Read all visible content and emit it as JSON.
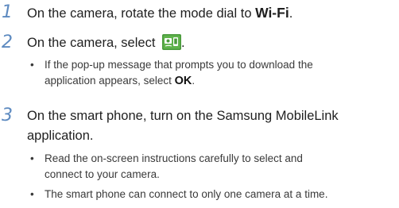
{
  "steps": [
    {
      "number": "1",
      "text_before": "On the camera, rotate the mode dial to ",
      "emphasis": "Wi-Fi",
      "text_after": "."
    },
    {
      "number": "2",
      "text_before": "On the camera, select ",
      "icon": "mobilelink-app-icon",
      "text_after": ".",
      "bullets": [
        {
          "line1": "If the pop-up message that prompts you to download the",
          "line2_before": "application appears, select ",
          "line2_bold": "OK",
          "line2_after": "."
        }
      ]
    },
    {
      "number": "3",
      "line1": "On the smart phone, turn on the Samsung MobileLink",
      "line2": "application.",
      "bullets": [
        {
          "line1": "Read the on-screen instructions carefully to select and",
          "line2": "connect to your camera."
        },
        {
          "line1": "The smart phone can connect to only one camera at a time."
        }
      ]
    }
  ],
  "bullet_glyph": "•",
  "colors": {
    "step_number": "#5d8ac0",
    "icon_green": "#4a9a3c"
  }
}
